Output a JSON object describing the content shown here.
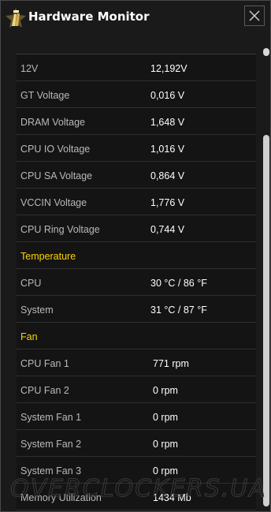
{
  "window": {
    "title": "Hardware Monitor"
  },
  "icons": {
    "logo": "marker-logo-icon",
    "close": "close-icon"
  },
  "colors": {
    "section_header": "#ffd200",
    "value": "#ffffff",
    "label": "#b9b9b9",
    "background": "#1a1a1a"
  },
  "rows": [
    {
      "type": "item",
      "label": "12V",
      "value": "12,192V"
    },
    {
      "type": "item",
      "label": "GT Voltage",
      "value": "0,016 V"
    },
    {
      "type": "item",
      "label": "DRAM Voltage",
      "value": "1,648 V"
    },
    {
      "type": "item",
      "label": "CPU IO Voltage",
      "value": "1,016 V"
    },
    {
      "type": "item",
      "label": "CPU SA Voltage",
      "value": "0,864 V"
    },
    {
      "type": "item",
      "label": "VCCIN Voltage",
      "value": "1,776 V"
    },
    {
      "type": "item",
      "label": "CPU Ring Voltage",
      "value": "0,744 V"
    },
    {
      "type": "section",
      "label": "Temperature"
    },
    {
      "type": "item",
      "label": "CPU",
      "value": "30 °C / 86 °F"
    },
    {
      "type": "item",
      "label": "System",
      "value": "31 °C / 87 °F"
    },
    {
      "type": "section",
      "label": "Fan"
    },
    {
      "type": "item",
      "label": "CPU Fan 1",
      "value": "771 rpm"
    },
    {
      "type": "item",
      "label": "CPU Fan 2",
      "value": "0 rpm"
    },
    {
      "type": "item",
      "label": "System Fan 1",
      "value": "0 rpm"
    },
    {
      "type": "item",
      "label": "System Fan 2",
      "value": "0 rpm"
    },
    {
      "type": "item",
      "label": "System Fan 3",
      "value": "0 rpm"
    },
    {
      "type": "item",
      "label": "Memory Utilization",
      "value": "1434 Mb"
    }
  ],
  "watermark": "OVERCLOCKERS.UA"
}
